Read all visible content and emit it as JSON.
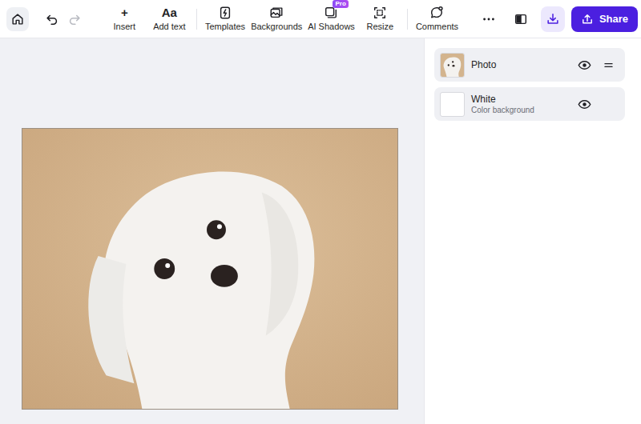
{
  "toolbar": {
    "undo": {
      "disabled": false
    },
    "redo": {
      "disabled": true
    },
    "tools": [
      {
        "label": "Insert",
        "glyph": "+"
      },
      {
        "label": "Add text",
        "glyph": "Aa"
      },
      {
        "label": "Templates"
      },
      {
        "label": "Backgrounds"
      },
      {
        "label": "AI Shadows",
        "badge": "Pro"
      },
      {
        "label": "Resize"
      },
      {
        "label": "Comments"
      }
    ],
    "share": "Share"
  },
  "layers": [
    {
      "title": "Photo",
      "kind": "photo",
      "visible": true,
      "draggable": true
    },
    {
      "title": "White",
      "subtitle": "Color background",
      "kind": "color",
      "visible": true,
      "draggable": false
    }
  ]
}
